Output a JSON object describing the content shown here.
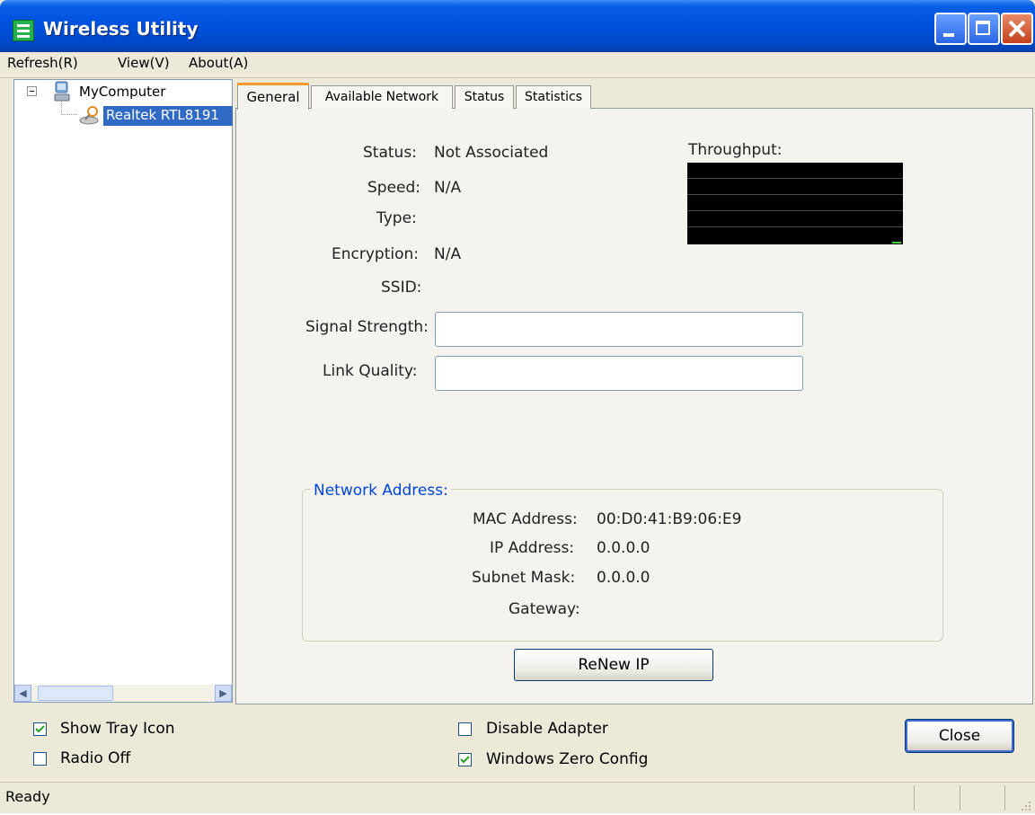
{
  "window": {
    "title": "Wireless Utility"
  },
  "menu": {
    "items": [
      "Refresh(R)",
      "View(V)",
      "About(A)"
    ]
  },
  "tree": {
    "root": "MyComputer",
    "adapter": "Realtek RTL8191"
  },
  "tabs": [
    "General",
    "Available Network",
    "Status",
    "Statistics"
  ],
  "general": {
    "status_label": "Status:",
    "status_value": "Not Associated",
    "speed_label": "Speed:",
    "speed_value": "N/A",
    "type_label": "Type:",
    "type_value": "",
    "encryption_label": "Encryption:",
    "encryption_value": "N/A",
    "ssid_label": "SSID:",
    "ssid_value": "",
    "signal_label": "Signal Strength:",
    "signal_value": "",
    "link_label": "Link Quality:",
    "link_value": "",
    "throughput_label": "Throughput:"
  },
  "network_address": {
    "legend": "Network Address:",
    "mac_label": "MAC Address:",
    "mac_value": "00:D0:41:B9:06:E9",
    "ip_label": "IP Address:",
    "ip_value": "0.0.0.0",
    "subnet_label": "Subnet Mask:",
    "subnet_value": "0.0.0.0",
    "gateway_label": "Gateway:",
    "gateway_value": ""
  },
  "renew_button": "ReNew IP",
  "options": {
    "show_tray_icon": {
      "label": "Show Tray Icon",
      "checked": true
    },
    "radio_off": {
      "label": "Radio Off",
      "checked": false
    },
    "disable_adapter": {
      "label": "Disable Adapter",
      "checked": false
    },
    "windows_zero_config": {
      "label": "Windows Zero Config",
      "checked": true
    }
  },
  "close_button": "Close",
  "statusbar": {
    "text": "Ready"
  }
}
